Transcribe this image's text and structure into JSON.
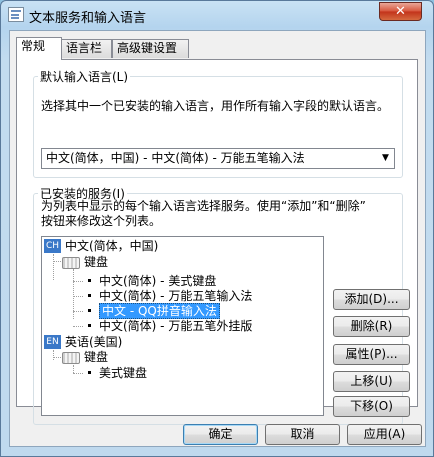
{
  "window": {
    "title": "文本服务和输入语言",
    "close_label": "✕"
  },
  "tabs": [
    {
      "label": "常规",
      "active": true
    },
    {
      "label": "语言栏",
      "active": false
    },
    {
      "label": "高级键设置",
      "active": false
    }
  ],
  "default_language": {
    "group_title": "默认输入语言(L)",
    "description": "选择其中一个已安装的输入语言，用作所有输入字段的默认语言。",
    "selected": "中文(简体，中国) - 中文(简体) - 万能五笔输入法"
  },
  "installed_services": {
    "group_title": "已安装的服务(I)",
    "description_line1": "为列表中显示的每个输入语言选择服务。使用“添加”和“删除”",
    "description_line2": "按钮来修改这个列表。",
    "tree": {
      "lang1": {
        "badge": "CH",
        "label": "中文(简体，中国)"
      },
      "lang1_keyboard": "键盘",
      "lang1_items": [
        "中文(简体) - 美式键盘",
        "中文(简体) - 万能五笔输入法",
        "中文 - QQ拼音输入法",
        "中文(简体) - 万能五笔外挂版"
      ],
      "selected_index": 2,
      "lang2": {
        "badge": "EN",
        "label": "英语(美国)"
      },
      "lang2_keyboard": "键盘",
      "lang2_items": [
        "美式键盘"
      ]
    },
    "buttons": {
      "add": "添加(D)...",
      "remove": "删除(R)",
      "properties": "属性(P)...",
      "move_up": "上移(U)",
      "move_down": "下移(O)"
    }
  },
  "footer": {
    "ok": "确定",
    "cancel": "取消",
    "apply": "应用(A)"
  }
}
